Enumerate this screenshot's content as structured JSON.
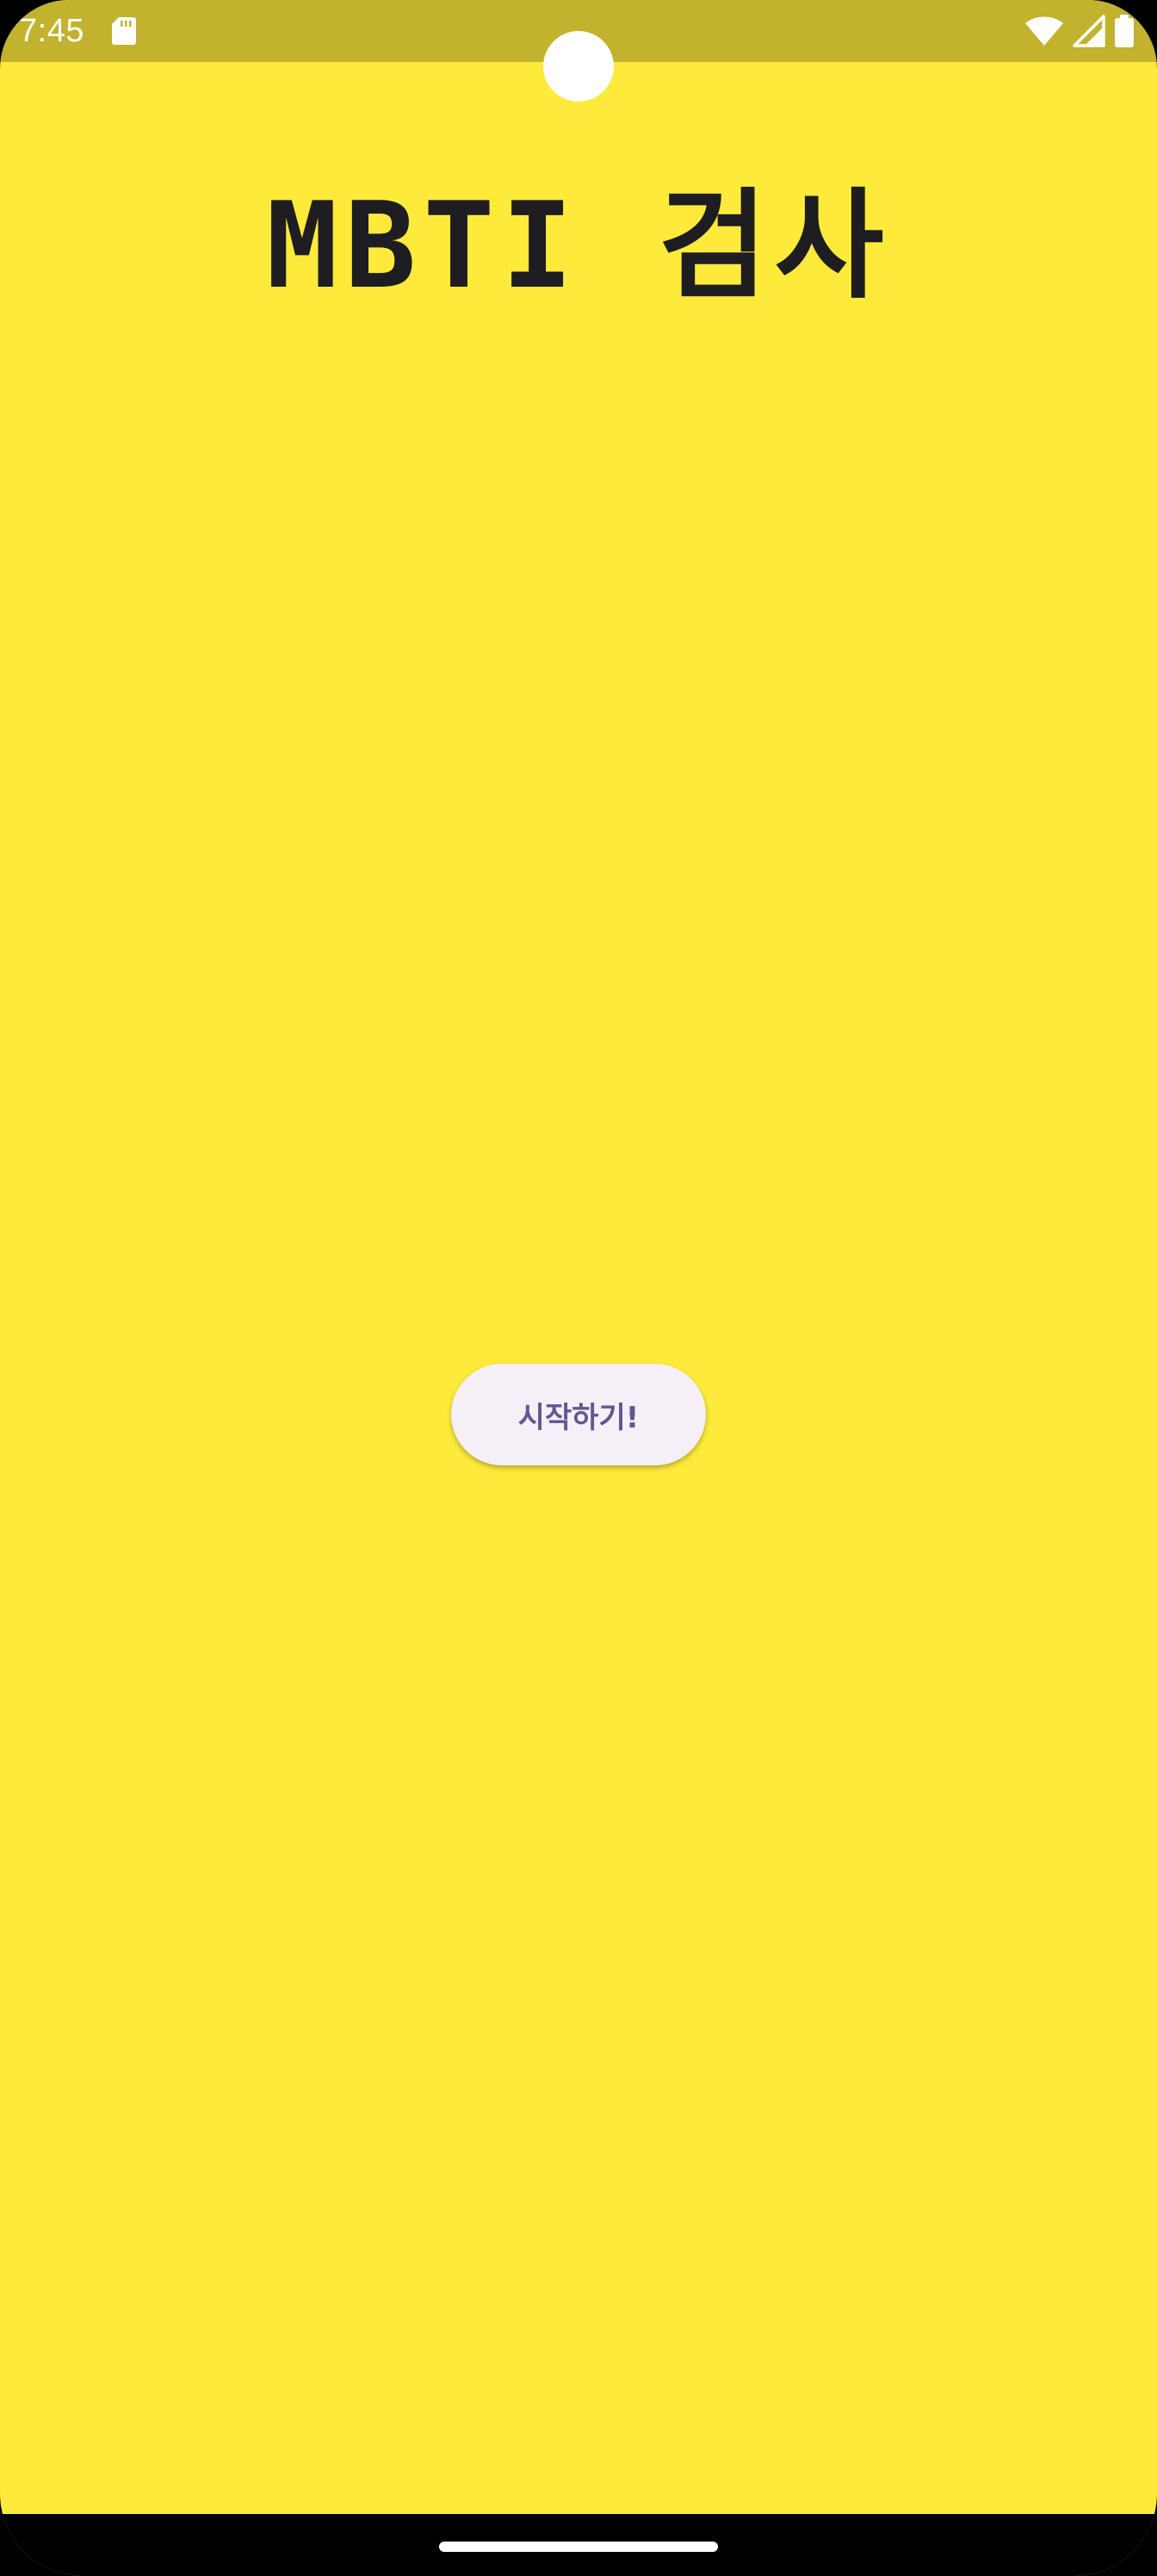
{
  "status_bar": {
    "time": "7:45",
    "icons": [
      "sd-card-icon",
      "wifi-icon",
      "cell-signal-icon",
      "battery-icon"
    ]
  },
  "main": {
    "title": "MBTI 검사",
    "start_button_label": "시작하기!"
  },
  "colors": {
    "background": "#FEEA3B",
    "status_bar": "#C2B22E",
    "title_text": "#1E1D22",
    "button_bg": "#F5EFF7",
    "button_text": "#65558F"
  }
}
